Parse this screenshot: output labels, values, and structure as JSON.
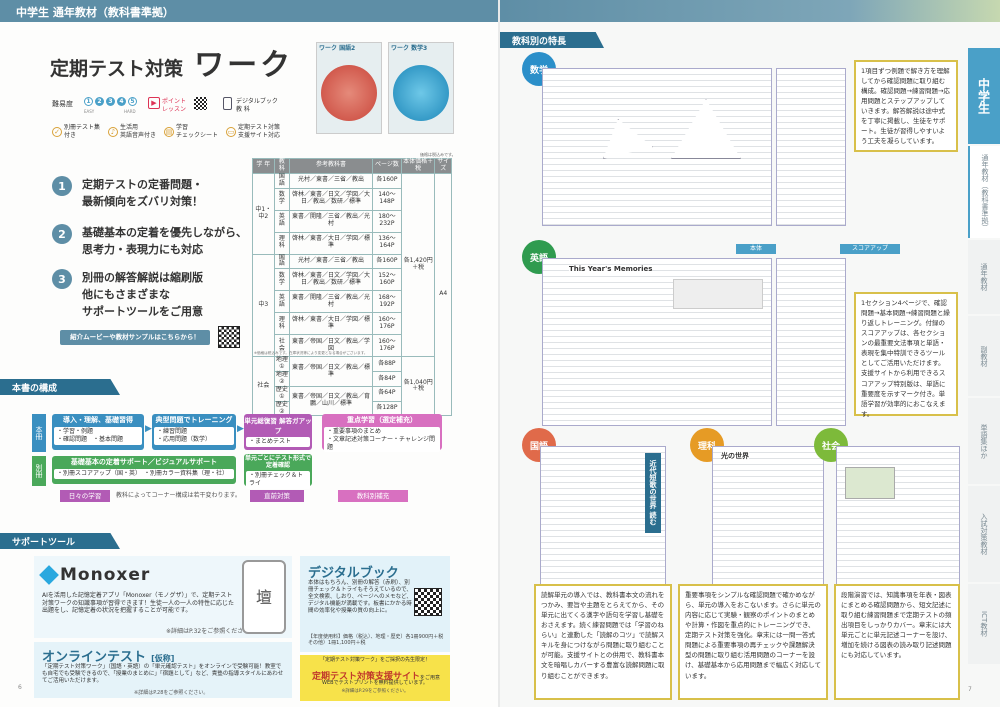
{
  "left": {
    "header": "中学生 通年教材（教科書準拠）",
    "title_a": "定期テスト対策",
    "title_b": "ワーク",
    "covers": [
      {
        "subject": "ワーク 国語",
        "grade": "2"
      },
      {
        "subject": "ワーク 数学",
        "grade": "3"
      }
    ],
    "difficulty_label": "難易度",
    "difficulty_levels": [
      "1",
      "2",
      "3",
      "4",
      "5"
    ],
    "difficulty_ends": [
      "EASY",
      "HARD"
    ],
    "icon_labels": [
      "ポイント\nレッスン",
      "デジタルブック\n教 科"
    ],
    "features": [
      "別冊テスト集\n付き",
      "生活用\n英語音声付き",
      "学習\nチェックシート",
      "定期テスト対策\n支援サイト対応"
    ],
    "points": [
      {
        "num": "1",
        "text": "定期テストの定番問題・\n最新傾向をズバリ対策！"
      },
      {
        "num": "2",
        "text": "基礎基本の定着を優先しながら、\n思考力・表現力にも対応"
      },
      {
        "num": "3",
        "text": "別冊の解答解説は縮刷版\n他にもさまざまな\nサポートツールをご用意"
      }
    ],
    "video_button": "紹介ムービーや教材サンプルはこちらから！",
    "table_note": "価格は税込みです。",
    "table_headers": [
      "学 年",
      "教 科",
      "参考教科書",
      "ページ数",
      "本体価格＋税",
      "サイズ"
    ],
    "table_rows": [
      [
        "中1・中2",
        "国 語",
        "光村／東書／三省／教出",
        "各160P",
        "",
        ""
      ],
      [
        "",
        "数 学",
        "啓林／東書／日文／学図／大日／教出／数研／標準",
        "140〜148P",
        "",
        ""
      ],
      [
        "",
        "英 語",
        "東書／開隆／三省／教出／光村",
        "180〜232P",
        "各1,420円＋税",
        "A4"
      ],
      [
        "",
        "理 科",
        "啓林／東書／大日／学図／標準",
        "136〜164P",
        "",
        ""
      ],
      [
        "中3",
        "国 語",
        "光村／東書／三省／教出",
        "各160P",
        "",
        ""
      ],
      [
        "",
        "数 学",
        "啓林／東書／日文／学図／大日／教出／数研／標準",
        "152〜160P",
        "",
        ""
      ],
      [
        "",
        "英 語",
        "東書／開隆／三省／教出／光村",
        "168〜192P",
        "",
        ""
      ],
      [
        "",
        "理 科",
        "啓林／東書／大日／学図／標準",
        "160〜176P",
        "",
        ""
      ],
      [
        "",
        "社 会",
        "東書／帝国／日文／教出／学図",
        "160〜176P",
        "",
        ""
      ],
      [
        "社会",
        "地理①",
        "東書／帝国／日文／教出／標準",
        "各88P",
        "",
        ""
      ],
      [
        "",
        "地理②",
        "",
        "各84P",
        "各1,040円＋税",
        ""
      ],
      [
        "",
        "歴史①",
        "東書／帝国／日文／教出／育鵬／山川／標準",
        "各64P",
        "",
        ""
      ],
      [
        "",
        "歴史②",
        "",
        "各128P",
        "",
        ""
      ]
    ],
    "table_footnote": "※価格は税込みです。在庫状況等により変更となる場合がございます。",
    "section_structure": "本書の構成",
    "row_labels": [
      "本冊",
      "別冊"
    ],
    "flow": [
      {
        "title": "導入・理解、基礎習得",
        "items": [
          "・学習・例題",
          "・確認問題　・基本問題"
        ]
      },
      {
        "title": "典型問題でトレーニング",
        "items": [
          "・練習問題",
          "・応用問題（数学）"
        ]
      },
      {
        "title": "単元総復習 解答ガアップ",
        "items": [
          "・まとめテスト"
        ]
      },
      {
        "title": "重点学習（選定補充）",
        "items": [
          "・重要事項のまとめ",
          "・文章記述対策コーナー・チャレンジ問題"
        ]
      }
    ],
    "bessatsu": {
      "title": "基礎基本の定着サポート／ビジュアルサポート",
      "items": [
        "・別冊スコアアップ（国・英）　・別冊カラー資料集（理・社）"
      ]
    },
    "bessatsu2": {
      "title": "単元ごとにテスト形式で定着確認",
      "items": [
        "・別冊チェック＆トライ"
      ]
    },
    "bottom_labels": [
      "日々の学習",
      "直前対策",
      "教科別補充"
    ],
    "flow_note": "教科によってコーナー構成は若干変わります。",
    "section_support": "サポートツール",
    "monoxer_logo": "Monoxer",
    "monoxer_text": "AIを活用した記憶定着アプリ「Monoxer（モノグザ）」で、定期テスト対策ワークの知識事項が習得できます！生徒一人の一人の特性に応じた出題をし、記憶定着の状況を把握することが可能です。",
    "monoxer_note": "※詳細はP.32をご参照ください。",
    "phone_kanji": "壇",
    "online_title": "オンラインテスト",
    "online_tag": "[仮称]",
    "online_text": "「定期テスト対策ワーク」（国語・英語）の「単元確認テスト」をオンラインで受験可能！教室でも自宅でも受験できるので、「授業のまとめに」「宿題として」など、貴塾の指導スタイルにあわせてご活用いただけます。",
    "online_note": "※詳細はP.28をご参照ください。",
    "digital_title": "デジタルブック",
    "digital_text": "本体はもちろん、別冊の解答（赤刷）、別冊チェック＆トライもそろえているので、全文検索、しおり、ページへのメモなど、デジタル機能が満載です。板書にかかる時間の効率化や授業の質の向上に。",
    "digital_price": "【年度使用料】価格（税込）、地理・歴史）各1冊900円＋税　その他）1冊1,100円＋税",
    "site_intro": "「定期テスト対策ワーク」をご採択の先生限定！",
    "site_title": "定期テスト対策支援サイト",
    "site_tag": "をご用意",
    "site_sub": "WEBでテストプリントを無料提供しています。",
    "site_note": "※詳細はP.29をご参照ください。",
    "page_num": "6"
  },
  "right": {
    "section": "教科別の特長",
    "subjects": [
      {
        "name": "数学",
        "color": "#2b8fc9"
      },
      {
        "name": "英語",
        "color": "#2f9b4f"
      },
      {
        "name": "国語",
        "color": "#e06a4a"
      },
      {
        "name": "理科",
        "color": "#e69b25"
      },
      {
        "name": "社会",
        "color": "#7dba3a"
      }
    ],
    "math_note": "1項目ずつ例題で解き方を理解してから確認問題に取り組む構成。確認問題→練習問題→応用問題とステップアップしていきます。解答解説は途中式を丁寧に掲載し、生徒をサポート。生徒が習得しやすいよう工夫を凝らしています。",
    "eng_note": "1セクション4ページで、確認問題→基本問題→練習問題と繰り返しトレーニング。付録のスコアアップは、各セクションの最重要文法事項と単語・表現を集中特訓できるツールとしてご活用いただけます。支援サイトから利用できるスコアアップ特別版は、単語に重要度を示すマーク付き。単語学習が効率的におこなえます。",
    "eng_labels": [
      "本体",
      "スコアアップ"
    ],
    "eng_page_title": "This Year's Memories",
    "jpn_note": "読解単元の導入では、教科書本文の流れをつかみ、要旨や主題をとらえてから、その単元に出てくる漢字や語句を学習し基礎をおさえます。続く練習問題では「学習のねらい」と連動した「読解のコツ」で読解スキルを身につけながら問題に取り組むことが可能。支援サイトとの併用で、教科書本文を暗唱しカバーする豊富な読解問題に取り組むことができます。",
    "sci_note": "重要事項をシンプルな確認問題で確かめながら、単元の導入をおこないます。さらに単元の内容に応じて実験・観察のポイントのまとめや計算・作図を重点的にトレーニングでき、定期テスト対策を強化。章末には一問一答式問題による重要事項の再チェックや課題解決型の問題に取り組む活用問題のコーナーを設け、基礎基本から応用問題まで幅広く対応しています。",
    "soc_note": "段階演習では、知識事項を年表・図表にまとめる確認問題から、短文記述に取り組む練習問題まで定期テストの頻出項目をしっかりカバー。章末には大単元ごとに単元記述コーナーを設け、増加を続ける図表の読み取り記述問題にも対応しています。",
    "jpn_title": "近代短歌の世界 読む",
    "sci_title": "光の世界",
    "side_tabs": [
      "中学生",
      "通年教材（教科書準拠）",
      "通年教材",
      "副教材",
      "単語集ほか",
      "入試対策教材",
      "ICT教材"
    ],
    "page_num": "7"
  }
}
